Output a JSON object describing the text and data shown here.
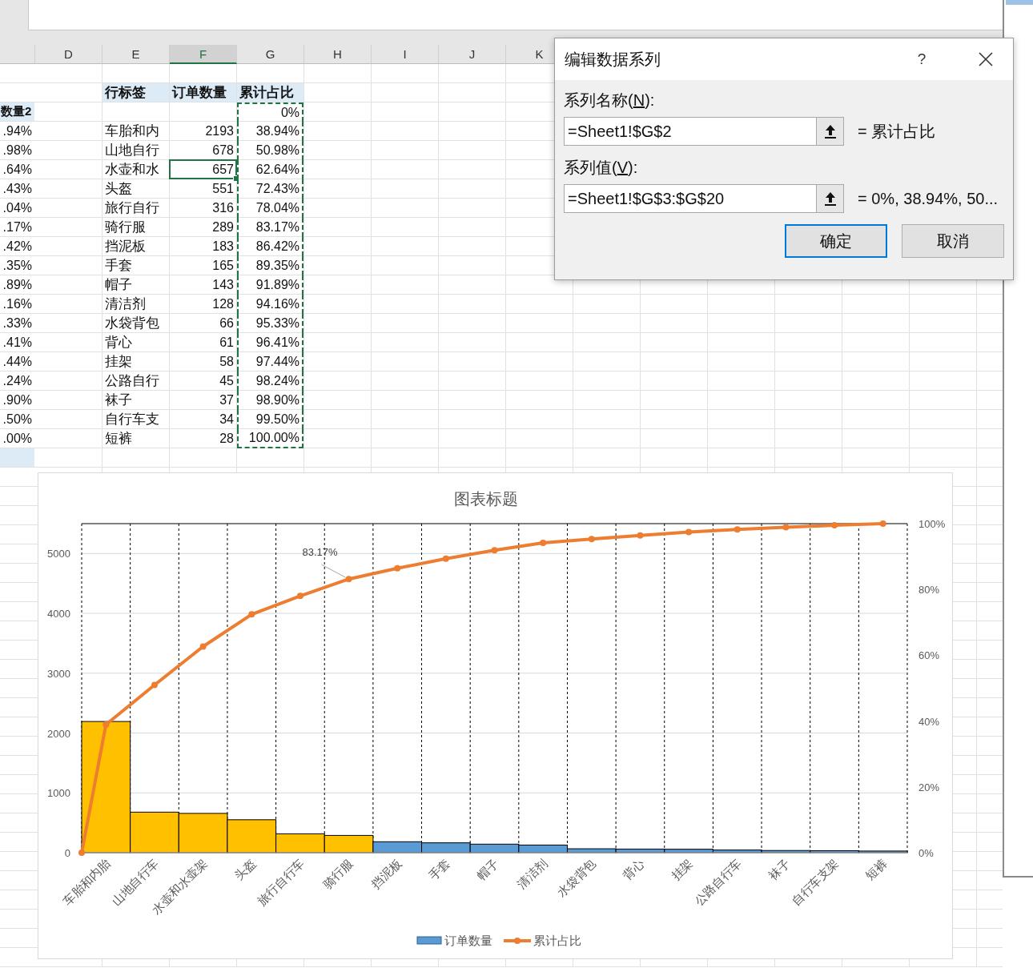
{
  "sheet": {
    "column_headers": [
      {
        "label": "D",
        "selected": false
      },
      {
        "label": "E",
        "selected": false
      },
      {
        "label": "F",
        "selected": true
      },
      {
        "label": "G",
        "selected": false
      },
      {
        "label": "H",
        "selected": false
      },
      {
        "label": "I",
        "selected": false
      },
      {
        "label": "J",
        "selected": false
      },
      {
        "label": "K",
        "selected": false
      }
    ],
    "table": {
      "header": [
        "行标签",
        "订单数量",
        "累计占比"
      ],
      "marquee": true,
      "first_row": {
        "column_c": "数量2",
        "cumulative": "0%"
      },
      "rows": [
        {
          "column_c": ".94%",
          "label": "车胎和内",
          "count": "2193",
          "cumulative": "38.94%",
          "selected": false
        },
        {
          "column_c": ".98%",
          "label": "山地自行",
          "count": "678",
          "cumulative": "50.98%",
          "selected": false
        },
        {
          "column_c": ".64%",
          "label": "水壶和水",
          "count": "657",
          "cumulative": "62.64%",
          "selected": true
        },
        {
          "column_c": ".43%",
          "label": "头盔",
          "count": "551",
          "cumulative": "72.43%",
          "selected": false
        },
        {
          "column_c": ".04%",
          "label": "旅行自行",
          "count": "316",
          "cumulative": "78.04%",
          "selected": false
        },
        {
          "column_c": ".17%",
          "label": "骑行服",
          "count": "289",
          "cumulative": "83.17%",
          "selected": false
        },
        {
          "column_c": ".42%",
          "label": "挡泥板",
          "count": "183",
          "cumulative": "86.42%",
          "selected": false
        },
        {
          "column_c": ".35%",
          "label": "手套",
          "count": "165",
          "cumulative": "89.35%",
          "selected": false
        },
        {
          "column_c": ".89%",
          "label": "帽子",
          "count": "143",
          "cumulative": "91.89%",
          "selected": false
        },
        {
          "column_c": ".16%",
          "label": "清洁剂",
          "count": "128",
          "cumulative": "94.16%",
          "selected": false
        },
        {
          "column_c": ".33%",
          "label": "水袋背包",
          "count": "66",
          "cumulative": "95.33%",
          "selected": false
        },
        {
          "column_c": ".41%",
          "label": "背心",
          "count": "61",
          "cumulative": "96.41%",
          "selected": false
        },
        {
          "column_c": ".44%",
          "label": "挂架",
          "count": "58",
          "cumulative": "97.44%",
          "selected": false
        },
        {
          "column_c": ".24%",
          "label": "公路自行",
          "count": "45",
          "cumulative": "98.24%",
          "selected": false
        },
        {
          "column_c": ".90%",
          "label": "袜子",
          "count": "37",
          "cumulative": "98.90%",
          "selected": false
        },
        {
          "column_c": ".50%",
          "label": "自行车支",
          "count": "34",
          "cumulative": "99.50%",
          "selected": false
        },
        {
          "column_c": ".00%",
          "label": "短裤",
          "count": "28",
          "cumulative": "100.00%",
          "selected": false
        }
      ]
    }
  },
  "chart": {
    "chart_data": {
      "type": "bar",
      "title": "图表标题",
      "categories": [
        "车胎和内胎",
        "山地自行车",
        "水壶和水壶架",
        "头盔",
        "旅行自行车",
        "骑行服",
        "挡泥板",
        "手套",
        "帽子",
        "清洁剂",
        "水袋背包",
        "背心",
        "挂架",
        "公路自行车",
        "袜子",
        "自行车支架",
        "短裤"
      ],
      "series": [
        {
          "name": "订单数量",
          "color": "#5b9bd5",
          "colors": [
            "#ffc000",
            "#ffc000",
            "#ffc000",
            "#ffc000",
            "#ffc000",
            "#ffc000",
            "#5b9bd5",
            "#5b9bd5",
            "#5b9bd5",
            "#5b9bd5",
            "#5b9bd5",
            "#5b9bd5",
            "#5b9bd5",
            "#5b9bd5",
            "#5b9bd5",
            "#5b9bd5",
            "#5b9bd5"
          ],
          "values": [
            2193,
            678,
            657,
            551,
            316,
            289,
            183,
            165,
            143,
            128,
            66,
            61,
            58,
            45,
            37,
            34,
            28
          ]
        },
        {
          "name": "累计占比",
          "type": "line",
          "marker": "circle",
          "axis": "y2",
          "color": "#ed7d31",
          "values": [
            38.94,
            50.98,
            62.64,
            72.43,
            78.04,
            83.17,
            86.42,
            89.35,
            91.89,
            94.16,
            95.33,
            96.41,
            97.44,
            98.24,
            98.9,
            99.5,
            100
          ]
        }
      ],
      "grid": true,
      "ylim": [
        0,
        5500
      ],
      "yticks": [
        0,
        1000,
        2000,
        3000,
        4000,
        5000
      ],
      "y2lim": [
        0,
        100
      ],
      "y2ticks": [
        {
          "value": 0,
          "label": "0%"
        },
        {
          "value": 20,
          "label": "20%"
        },
        {
          "value": 40,
          "label": "40%"
        },
        {
          "value": 60,
          "label": "60%"
        },
        {
          "value": 80,
          "label": "80%"
        },
        {
          "value": 100,
          "label": "100%"
        }
      ],
      "legend": true,
      "annotations": [
        "83.17%"
      ]
    }
  },
  "dialog": {
    "title": "编辑数据系列",
    "help": "?",
    "fields": [
      {
        "label_parts": [
          "系列名称(",
          "N",
          "):"
        ],
        "value": "=Sheet1!$G$2",
        "result": "= 累计占比"
      },
      {
        "label_parts": [
          "系列值(",
          "V",
          "):"
        ],
        "value": "=Sheet1!$G$3:$G$20",
        "result": "= 0%, 38.94%, 50..."
      }
    ],
    "buttons": [
      {
        "label": "确定",
        "default": true
      },
      {
        "label": "取消",
        "default": false
      }
    ]
  }
}
